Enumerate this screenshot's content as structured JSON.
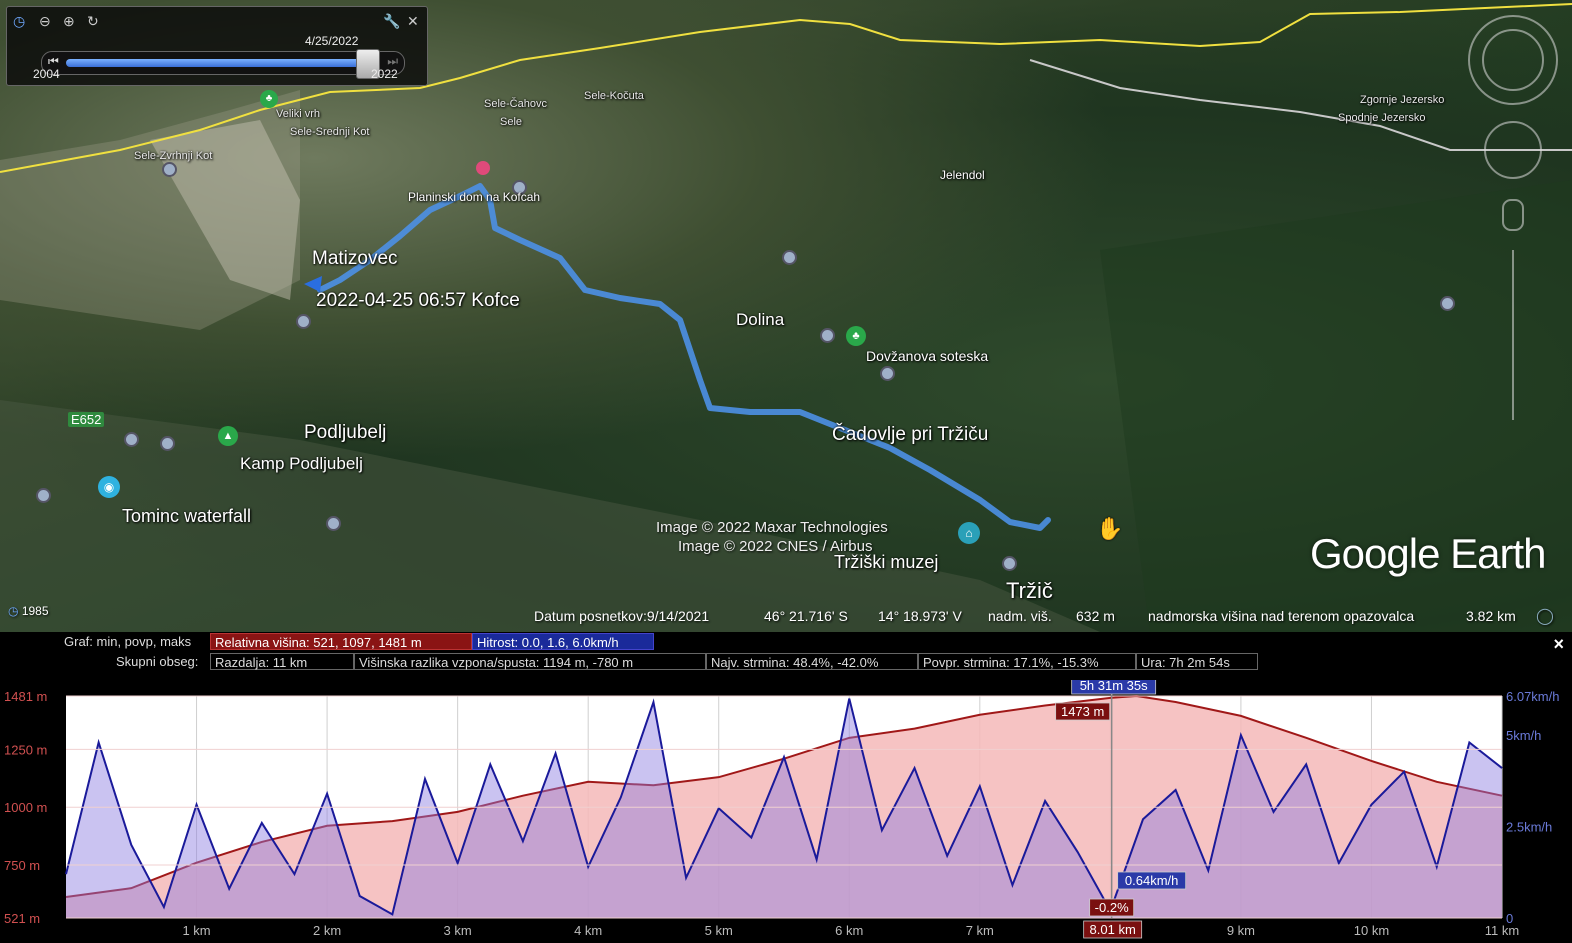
{
  "timeline": {
    "date": "4/25/2022",
    "start_year": "2004",
    "end_year": "2022",
    "progress": 0.96,
    "historical_year": "1985"
  },
  "map": {
    "labels_big": [
      {
        "text": "Matizovec"
      },
      {
        "text": "2022-04-25 06:57 Kofce"
      },
      {
        "text": "Podljubelj"
      },
      {
        "text": "Čadovlje pri Tržiču"
      },
      {
        "text": "Tržič"
      }
    ],
    "labels_med": [
      {
        "text": "Dolina"
      },
      {
        "text": "Kamp Podljubelj"
      },
      {
        "text": "Tominc waterfall"
      },
      {
        "text": "Tržiški muzej"
      },
      {
        "text": "Dovžanova soteska"
      },
      {
        "text": "Planinski dom na Kofcah"
      },
      {
        "text": "Jelendol"
      },
      {
        "text": "E652"
      }
    ],
    "labels_small": [
      {
        "text": "Sele-Zvrhnji Kot"
      },
      {
        "text": "Sele-Srednji Kot"
      },
      {
        "text": "Veliki vrh"
      },
      {
        "text": "Sele-Čahovc"
      },
      {
        "text": "Sele"
      },
      {
        "text": "Sele-Kočuta"
      },
      {
        "text": "Zgornje Jezersko"
      },
      {
        "text": "Spodnje Jezersko"
      }
    ],
    "copyright_1": "Image © 2022 Maxar Technologies",
    "copyright_2": "Image © 2022 CNES / Airbus",
    "logo": "Google Earth"
  },
  "status": {
    "date": "Datum posnetkov:9/14/2021",
    "lat": "46° 21.716' S",
    "lon": "14° 18.973' V",
    "elev_label": "nadm. viš.",
    "elev": "632 m",
    "eye_label": "nadmorska višina nad terenom opazovalca",
    "eye": "3.82 km"
  },
  "profile": {
    "row1_label": "Graf: min, povp, maks",
    "row1_chip1": "Relativna višina: 521, 1097, 1481 m",
    "row1_chip2": "Hitrost: 0.0, 1.6, 6.0km/h",
    "row2_label": "Skupni obseg:",
    "row2_chips": [
      "Razdalja: 11 km",
      "Višinska razlika vzpona/spusta: 1194 m, -780 m",
      "Najv. strmina: 48.4%, -42.0%",
      "Povpr. strmina: 17.1%, -15.3%",
      "Ura: 7h 2m 54s"
    ],
    "close": "×",
    "cursor_time": "5h 31m 35s",
    "cursor_elev": "1473 m",
    "cursor_speed": "0.64km/h",
    "cursor_slope": "-0.2%",
    "cursor_dist": "8.01 km"
  },
  "chart_data": {
    "type": "line",
    "xlabel": "",
    "ylabel": "",
    "x_ticks": [
      "1 km",
      "2 km",
      "3 km",
      "4 km",
      "5 km",
      "6 km",
      "7 km",
      "8 km",
      "9 km",
      "10 km",
      "11 km"
    ],
    "y_left_ticks": [
      "1481 m",
      "1250 m",
      "1000 m",
      "750 m",
      "521 m"
    ],
    "y_right_ticks": [
      "6.07km/h",
      "5km/h",
      "2.5km/h",
      "0"
    ],
    "xlim": [
      0,
      11
    ],
    "ylim_elevation": [
      521,
      1481
    ],
    "ylim_speed": [
      0,
      6.07
    ],
    "cursor_x": 8.01,
    "series": [
      {
        "name": "Relativna višina",
        "color": "#a01818",
        "x": [
          0,
          0.5,
          1,
          1.5,
          2,
          2.5,
          3,
          3.5,
          4,
          4.5,
          5,
          5.5,
          6,
          6.5,
          7,
          7.5,
          8,
          8.2,
          8.5,
          9,
          9.5,
          10,
          10.5,
          11
        ],
        "values": [
          612,
          650,
          760,
          850,
          920,
          940,
          980,
          1050,
          1110,
          1095,
          1130,
          1210,
          1300,
          1340,
          1400,
          1440,
          1473,
          1481,
          1455,
          1395,
          1300,
          1200,
          1110,
          1050
        ]
      },
      {
        "name": "Hitrost",
        "color": "#1a1a9a",
        "x": [
          0,
          0.25,
          0.5,
          0.75,
          1,
          1.25,
          1.5,
          1.75,
          2,
          2.25,
          2.5,
          2.75,
          3,
          3.25,
          3.5,
          3.75,
          4,
          4.25,
          4.5,
          4.75,
          5,
          5.25,
          5.5,
          5.75,
          6,
          6.25,
          6.5,
          6.75,
          7,
          7.25,
          7.5,
          7.75,
          8,
          8.25,
          8.5,
          8.75,
          9,
          9.25,
          9.5,
          9.75,
          10,
          10.25,
          10.5,
          10.75,
          11
        ],
        "values": [
          1.2,
          4.8,
          2.0,
          0.3,
          3.1,
          0.8,
          2.6,
          1.2,
          3.4,
          0.6,
          0.1,
          3.8,
          1.5,
          4.2,
          2.1,
          4.5,
          1.4,
          3.3,
          5.9,
          1.1,
          3.0,
          2.2,
          4.4,
          1.6,
          6.0,
          2.4,
          4.1,
          1.7,
          3.6,
          0.9,
          3.2,
          1.8,
          0.2,
          2.7,
          3.5,
          1.3,
          5.0,
          2.9,
          4.2,
          1.5,
          3.1,
          4.0,
          1.4,
          4.8,
          4.1
        ]
      }
    ]
  }
}
